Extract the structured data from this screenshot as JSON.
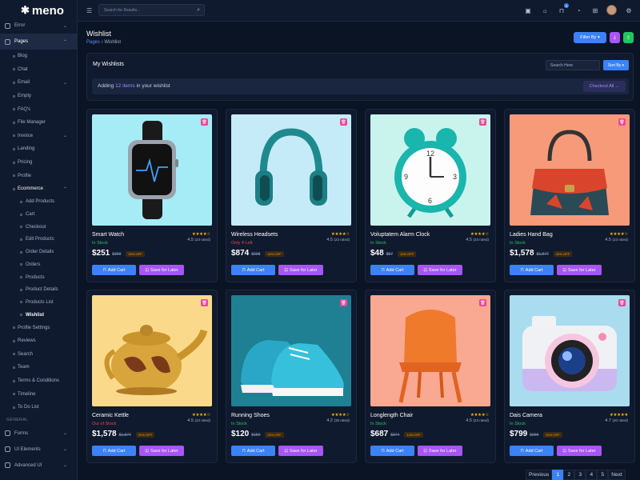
{
  "brand": {
    "name": "meno",
    "mark": "✱"
  },
  "header": {
    "search_placeholder": "Search for Results...",
    "cart_count": "5"
  },
  "sidebar": {
    "top_items": [
      {
        "label": "Error",
        "type": "group"
      },
      {
        "label": "Pages",
        "type": "group",
        "active": true
      }
    ],
    "pages_items": [
      "Blog",
      "Chat",
      "Email",
      "Empty",
      "FAQ's",
      "File Manager",
      "Invoice",
      "Landing",
      "Pricing",
      "Profile"
    ],
    "ecommerce_label": "Ecommerce",
    "ecommerce_items": [
      "Add Products",
      "Cart",
      "Checkout",
      "Edit Products",
      "Order Details",
      "Orders",
      "Products",
      "Product Details",
      "Products List",
      "Wishlist"
    ],
    "after_items": [
      "Profile Settings",
      "Reviews",
      "Search",
      "Team",
      "Terms & Conditions",
      "Timeline",
      "To Do List"
    ],
    "category": "GENERAL",
    "general_items": [
      "Forms",
      "UI Elements",
      "Advanced UI"
    ]
  },
  "page": {
    "title": "Wishlist",
    "breadcrumb_parent": "Pages",
    "breadcrumb_current": "Wishlist",
    "filter_label": "Filter By"
  },
  "wishlist": {
    "title": "My Wishlists",
    "search_placeholder": "Search Here",
    "sort_label": "Sort By",
    "info_prefix": "Adding",
    "info_count": "12 items",
    "info_suffix": "in your wishlist",
    "checkout_label": "Checkout All"
  },
  "products": [
    {
      "name": "Smart Watch",
      "stars": "★★★★☆",
      "rating": "4.5",
      "reviews": "(23 rated)",
      "stock": "In Stock",
      "stock_type": "in",
      "price": "$251",
      "old": "$399",
      "off": "30% OFF",
      "bg": "#a6ecf6",
      "icon": "smart-watch"
    },
    {
      "name": "Wireless Headsets",
      "stars": "★★★★☆",
      "rating": "4.5",
      "reviews": "(23 rated)",
      "stock": "Only 4 Left",
      "stock_type": "few",
      "price": "$874",
      "old": "$998",
      "off": "30% OFF",
      "bg": "#c6ebf8",
      "icon": "headphones"
    },
    {
      "name": "Voluptatem Alarm Clock",
      "stars": "★★★★☆",
      "rating": "4.5",
      "reviews": "(23 rated)",
      "stock": "In Stock",
      "stock_type": "in",
      "price": "$48",
      "old": "$57",
      "off": "10% OFF",
      "bg": "#c9f4ee",
      "icon": "alarm-clock"
    },
    {
      "name": "Ladies Hand Bag",
      "stars": "★★★★☆",
      "rating": "4.5",
      "reviews": "(23 rated)",
      "stock": "In Stock",
      "stock_type": "in",
      "price": "$1,578",
      "old": "$1,877",
      "off": "20% OFF",
      "bg": "#f79a7a",
      "icon": "handbag"
    },
    {
      "name": "Ceramic Kettle",
      "stars": "★★★★☆",
      "rating": "4.5",
      "reviews": "(23 rated)",
      "stock": "Out of Stock",
      "stock_type": "out",
      "price": "$1,578",
      "old": "$1,877",
      "off": "20% OFF",
      "bg": "#fbd98a",
      "icon": "kettle"
    },
    {
      "name": "Running Shoes",
      "stars": "★★★★☆",
      "rating": "4.2",
      "reviews": "(35 rated)",
      "stock": "In Stock",
      "stock_type": "in",
      "price": "$120",
      "old": "$150",
      "off": "20% OFF",
      "bg": "#1f7f93",
      "icon": "shoes"
    },
    {
      "name": "Longlength Chair",
      "stars": "★★★★☆",
      "rating": "4.5",
      "reviews": "(23 rated)",
      "stock": "In Stock",
      "stock_type": "in",
      "price": "$687",
      "old": "$874",
      "off": "14% OFF",
      "bg": "#f9a891",
      "icon": "chair"
    },
    {
      "name": "Dais Camera",
      "stars": "★★★★★",
      "rating": "4.7",
      "reviews": "(30 rated)",
      "stock": "In Stock",
      "stock_type": "in",
      "price": "$799",
      "old": "$999",
      "off": "20% OFF",
      "bg": "#a9dcee",
      "icon": "camera"
    }
  ],
  "buttons": {
    "add_cart": "Add Cart",
    "save_later": "Save for Later"
  },
  "pagination": {
    "prev": "Previous",
    "pages": [
      "1",
      "2",
      "3",
      "4",
      "5"
    ],
    "next": "Next",
    "current": "1"
  },
  "colors": {
    "accent": "#3b82f6",
    "purple": "#a855f7",
    "green": "#22c55e",
    "pink": "#ec4899",
    "sidebar": "#101a2e",
    "body": "#0b1425"
  }
}
